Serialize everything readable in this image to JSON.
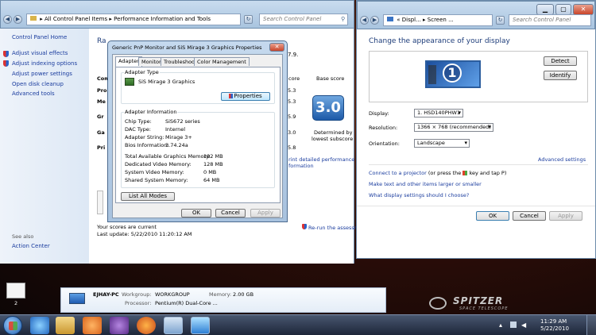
{
  "control_panel": {
    "breadcrumb": [
      "All Control Panel Items",
      "Performance Information and Tools"
    ],
    "search_placeholder": "Search Control Panel",
    "sidebar": {
      "home": "Control Panel Home",
      "items": [
        "Adjust visual effects",
        "Adjust indexing options",
        "Adjust power settings",
        "Open disk cleanup",
        "Advanced tools"
      ],
      "see_also": "See also",
      "action_center": "Action Center"
    },
    "partial_texts": {
      "ra": "Ra",
      "seven_nine": "7.9.",
      "com": "Com",
      "pro": "Pro",
      "me": "Me",
      "gr": "Gr",
      "ga": "Ga",
      "pri": "Pri",
      "score_col": "core",
      "base_score": "Base score",
      "scores": [
        "5.3",
        "5.3",
        "5.9",
        "3.0",
        "5.8"
      ],
      "print_detailed": "rint detailed performance an",
      "information": "formation",
      "rerun": "Re-run the assessme"
    },
    "big_score": "3.0",
    "determined_by": [
      "Determined by",
      "lowest subscore"
    ],
    "scores_current": "Your scores are current",
    "last_update": "Last update: 5/22/2010 11:20:12 AM"
  },
  "props_dialog": {
    "title": "Generic PnP Monitor and SiS Mirage 3 Graphics Properties",
    "tabs": [
      "Adapter",
      "Monitor",
      "Troubleshoot",
      "Color Management"
    ],
    "adapter_type_label": "Adapter Type",
    "adapter_name": "SiS Mirage 3 Graphics",
    "properties_button": "Properties",
    "adapter_info_label": "Adapter Information",
    "info_rows": [
      {
        "label": "Chip Type:",
        "value": "SiS672 series"
      },
      {
        "label": "DAC Type:",
        "value": "Internel"
      },
      {
        "label": "Adapter String:",
        "value": "Mirage 3+"
      },
      {
        "label": "Bios Information:",
        "value": "3.74.24a"
      }
    ],
    "memory_rows": [
      {
        "label": "Total Available Graphics Memory:",
        "value": "192 MB"
      },
      {
        "label": "Dedicated Video Memory:",
        "value": "128 MB"
      },
      {
        "label": "System Video Memory:",
        "value": "0 MB"
      },
      {
        "label": "Shared System Memory:",
        "value": "64 MB"
      }
    ],
    "list_all_modes": "List All Modes",
    "ok": "OK",
    "cancel": "Cancel",
    "apply": "Apply"
  },
  "display_window": {
    "breadcrumb": [
      "Displ...",
      "Screen ..."
    ],
    "search_placeholder": "Search Control Panel",
    "heading": "Change the appearance of your display",
    "detect": "Detect",
    "identify": "Identify",
    "monitor_number": "1",
    "display_label": "Display:",
    "display_value": "1. HSD140PHW1",
    "resolution_label": "Resolution:",
    "resolution_value": "1366 × 768 (recommended)",
    "orientation_label": "Orientation:",
    "orientation_value": "Landscape",
    "advanced_settings": "Advanced settings",
    "projector_link": "Connect to a projector",
    "projector_rest_a": "(or press the",
    "projector_rest_b": "key and tap P)",
    "text_size_link": "Make text and other items larger or smaller",
    "choose_link": "What display settings should I choose?",
    "ok": "OK",
    "cancel": "Cancel",
    "apply": "Apply"
  },
  "computer_info": {
    "name": "EJHAY-PC",
    "workgroup_label": "Workgroup:",
    "workgroup": "WORKGROUP",
    "memory_label": "Memory:",
    "memory": "2.00 GB",
    "processor_label": "Processor:",
    "processor": "Pentium(R) Dual-Core ..."
  },
  "desktop": {
    "icon_label": "2",
    "watermark": "SPITZER",
    "watermark_sub": "SPACE TELESCOPE"
  },
  "taskbar": {
    "time": "11:29 AM",
    "date": "5/22/2010"
  }
}
